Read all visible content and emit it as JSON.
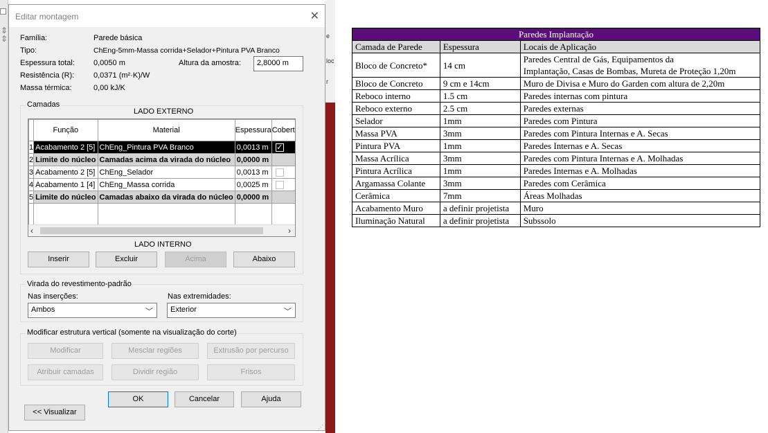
{
  "dialog": {
    "title": "Editar montagem",
    "props": {
      "familia_label": "Família:",
      "familia_value": "Parede básica",
      "tipo_label": "Tipo:",
      "tipo_value": "ChEng-5mm-Massa corrida+Selador+Pintura PVA Branco",
      "espessura_label": "Espessura total:",
      "espessura_value": "0,0050 m",
      "altura_label": "Altura da amostra:",
      "altura_value": "2,8000 m",
      "resistencia_label": "Resistência (R):",
      "resistencia_value": "0,0371 (m²·K)/W",
      "massa_label": "Massa térmica:",
      "massa_value": "0,00 kJ/K"
    },
    "layers": {
      "group_title": "Camadas",
      "exterior_label": "LADO EXTERNO",
      "interior_label": "LADO INTERNO",
      "columns": [
        "Função",
        "Material",
        "Espessura",
        "Cobertura"
      ],
      "rows": [
        {
          "n": "1",
          "funcao": "Acabamento 2 [5]",
          "material": "ChEng_Pintura PVA Branco",
          "espessura": "0,0013 m",
          "cobertura": "checked"
        },
        {
          "n": "2",
          "funcao": "Limite do núcleo",
          "material": "Camadas acima da virada do núcleo",
          "espessura": "0,0000 m",
          "cobertura": "none"
        },
        {
          "n": "3",
          "funcao": "Acabamento 2 [5]",
          "material": "ChEng_Selador",
          "espessura": "0,0013 m",
          "cobertura": "unchecked"
        },
        {
          "n": "4",
          "funcao": "Acabamento 1 [4]",
          "material": "ChEng_Massa corrida",
          "espessura": "0,0025 m",
          "cobertura": "unchecked"
        },
        {
          "n": "5",
          "funcao": "Limite do núcleo",
          "material": "Camadas abaixo da virada do núcleo",
          "espessura": "0,0000 m",
          "cobertura": "none"
        }
      ],
      "buttons": {
        "inserir": "Inserir",
        "excluir": "Excluir",
        "acima": "Acima",
        "abaixo": "Abaixo"
      }
    },
    "wrapping": {
      "group_title": "Virada do revestimento-padrão",
      "insercoes_label": "Nas inserções:",
      "insercoes_value": "Ambos",
      "extremidades_label": "Nas extremidades:",
      "extremidades_value": "Exterior"
    },
    "vertical": {
      "group_title": "Modificar estrutura vertical (somente na visualização do corte)",
      "modificar": "Modificar",
      "mesclar": "Mesclar regiões",
      "extrusao": "Extrusão por percurso",
      "atribuir": "Atribuir camadas",
      "dividir": "Dividir região",
      "frisos": "Frisos"
    },
    "footer": {
      "ok": "OK",
      "cancelar": "Cancelar",
      "ajuda": "Ajuda",
      "visualizar": "<< Visualizar"
    }
  },
  "background": {
    "right_text_1": "e",
    "right_text_2": "loc",
    "right_text_3": "r"
  },
  "spec_table": {
    "title": "Paredes Implantação",
    "header": [
      "Camada de Parede",
      "Espessura",
      "Locais de Aplicação"
    ],
    "rows": [
      {
        "camada": "Bloco de Concreto*",
        "espessura": "14 cm",
        "locais_1": "Paredes Central de Gás, Equipamentos da",
        "locais_2": "Implantação, Casas de Bombas, Mureta de Proteção 1,20m"
      },
      {
        "camada": "Bloco de Concreto",
        "espessura": "9 cm e 14cm",
        "locais_1": "Muro de Divisa e Muro do Garden com altura de 2,20m"
      },
      {
        "camada": "Reboco interno",
        "espessura": "1.5 cm",
        "locais_1": "Paredes internas com pintura"
      },
      {
        "camada": "Reboco externo",
        "espessura": "2.5 cm",
        "locais_1": "Paredes externas"
      },
      {
        "camada": "Selador",
        "espessura": "1mm",
        "locais_1": "Paredes com Pintura"
      },
      {
        "camada": "Massa PVA",
        "espessura": "3mm",
        "locais_1": "Paredes com Pintura Internas e A. Secas"
      },
      {
        "camada": "Pintura PVA",
        "espessura": "1mm",
        "locais_1": "Paredes Internas e A. Secas"
      },
      {
        "camada": "Massa Acrílica",
        "espessura": "3mm",
        "locais_1": "Paredes com Pintura Internas e A. Molhadas"
      },
      {
        "camada": "Pintura Acrílica",
        "espessura": "1mm",
        "locais_1": "Paredes Internas e A. Molhadas"
      },
      {
        "camada": "Argamassa Colante",
        "espessura": "3mm",
        "locais_1": "Paredes com Cerâmica"
      },
      {
        "camada": "Cerâmica",
        "espessura": "7mm",
        "locais_1": "Áreas Molhadas"
      },
      {
        "camada": "Acabamento Muro",
        "espessura": "a definir projetista",
        "locais_1": "Muro"
      },
      {
        "camada": "Iluminação Natural",
        "espessura": "a definir projetista",
        "locais_1": "Subssolo"
      }
    ]
  },
  "colors": {
    "spec_title_bg": "#5b0e7a",
    "selected_row": "#000000",
    "ok_border": "#0078d7"
  }
}
